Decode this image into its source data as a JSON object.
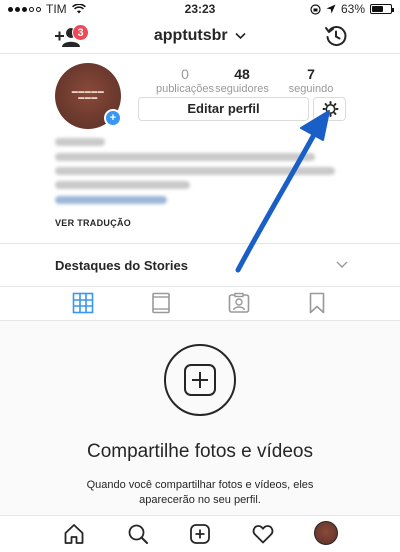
{
  "status_bar": {
    "carrier": "TIM",
    "time": "23:23",
    "battery": "63%",
    "battery_level": 0.63
  },
  "header": {
    "username": "apptutsbr",
    "notification_count": "3"
  },
  "profile": {
    "stats": [
      {
        "value": "0",
        "label": "publicações"
      },
      {
        "value": "48",
        "label": "seguidores"
      },
      {
        "value": "7",
        "label": "seguindo"
      }
    ],
    "edit_profile_label": "Editar perfil",
    "see_translation": "VER TRADUÇÃO"
  },
  "stories": {
    "label": "Destaques do Stories"
  },
  "empty_state": {
    "title": "Compartilhe fotos e vídeos",
    "description": "Quando você compartilhar fotos e vídeos, eles aparecerão no seu perfil."
  },
  "colors": {
    "accent_blue": "#3897f0",
    "badge_red": "#ed4956",
    "arrow_blue": "#1a5fc8"
  }
}
